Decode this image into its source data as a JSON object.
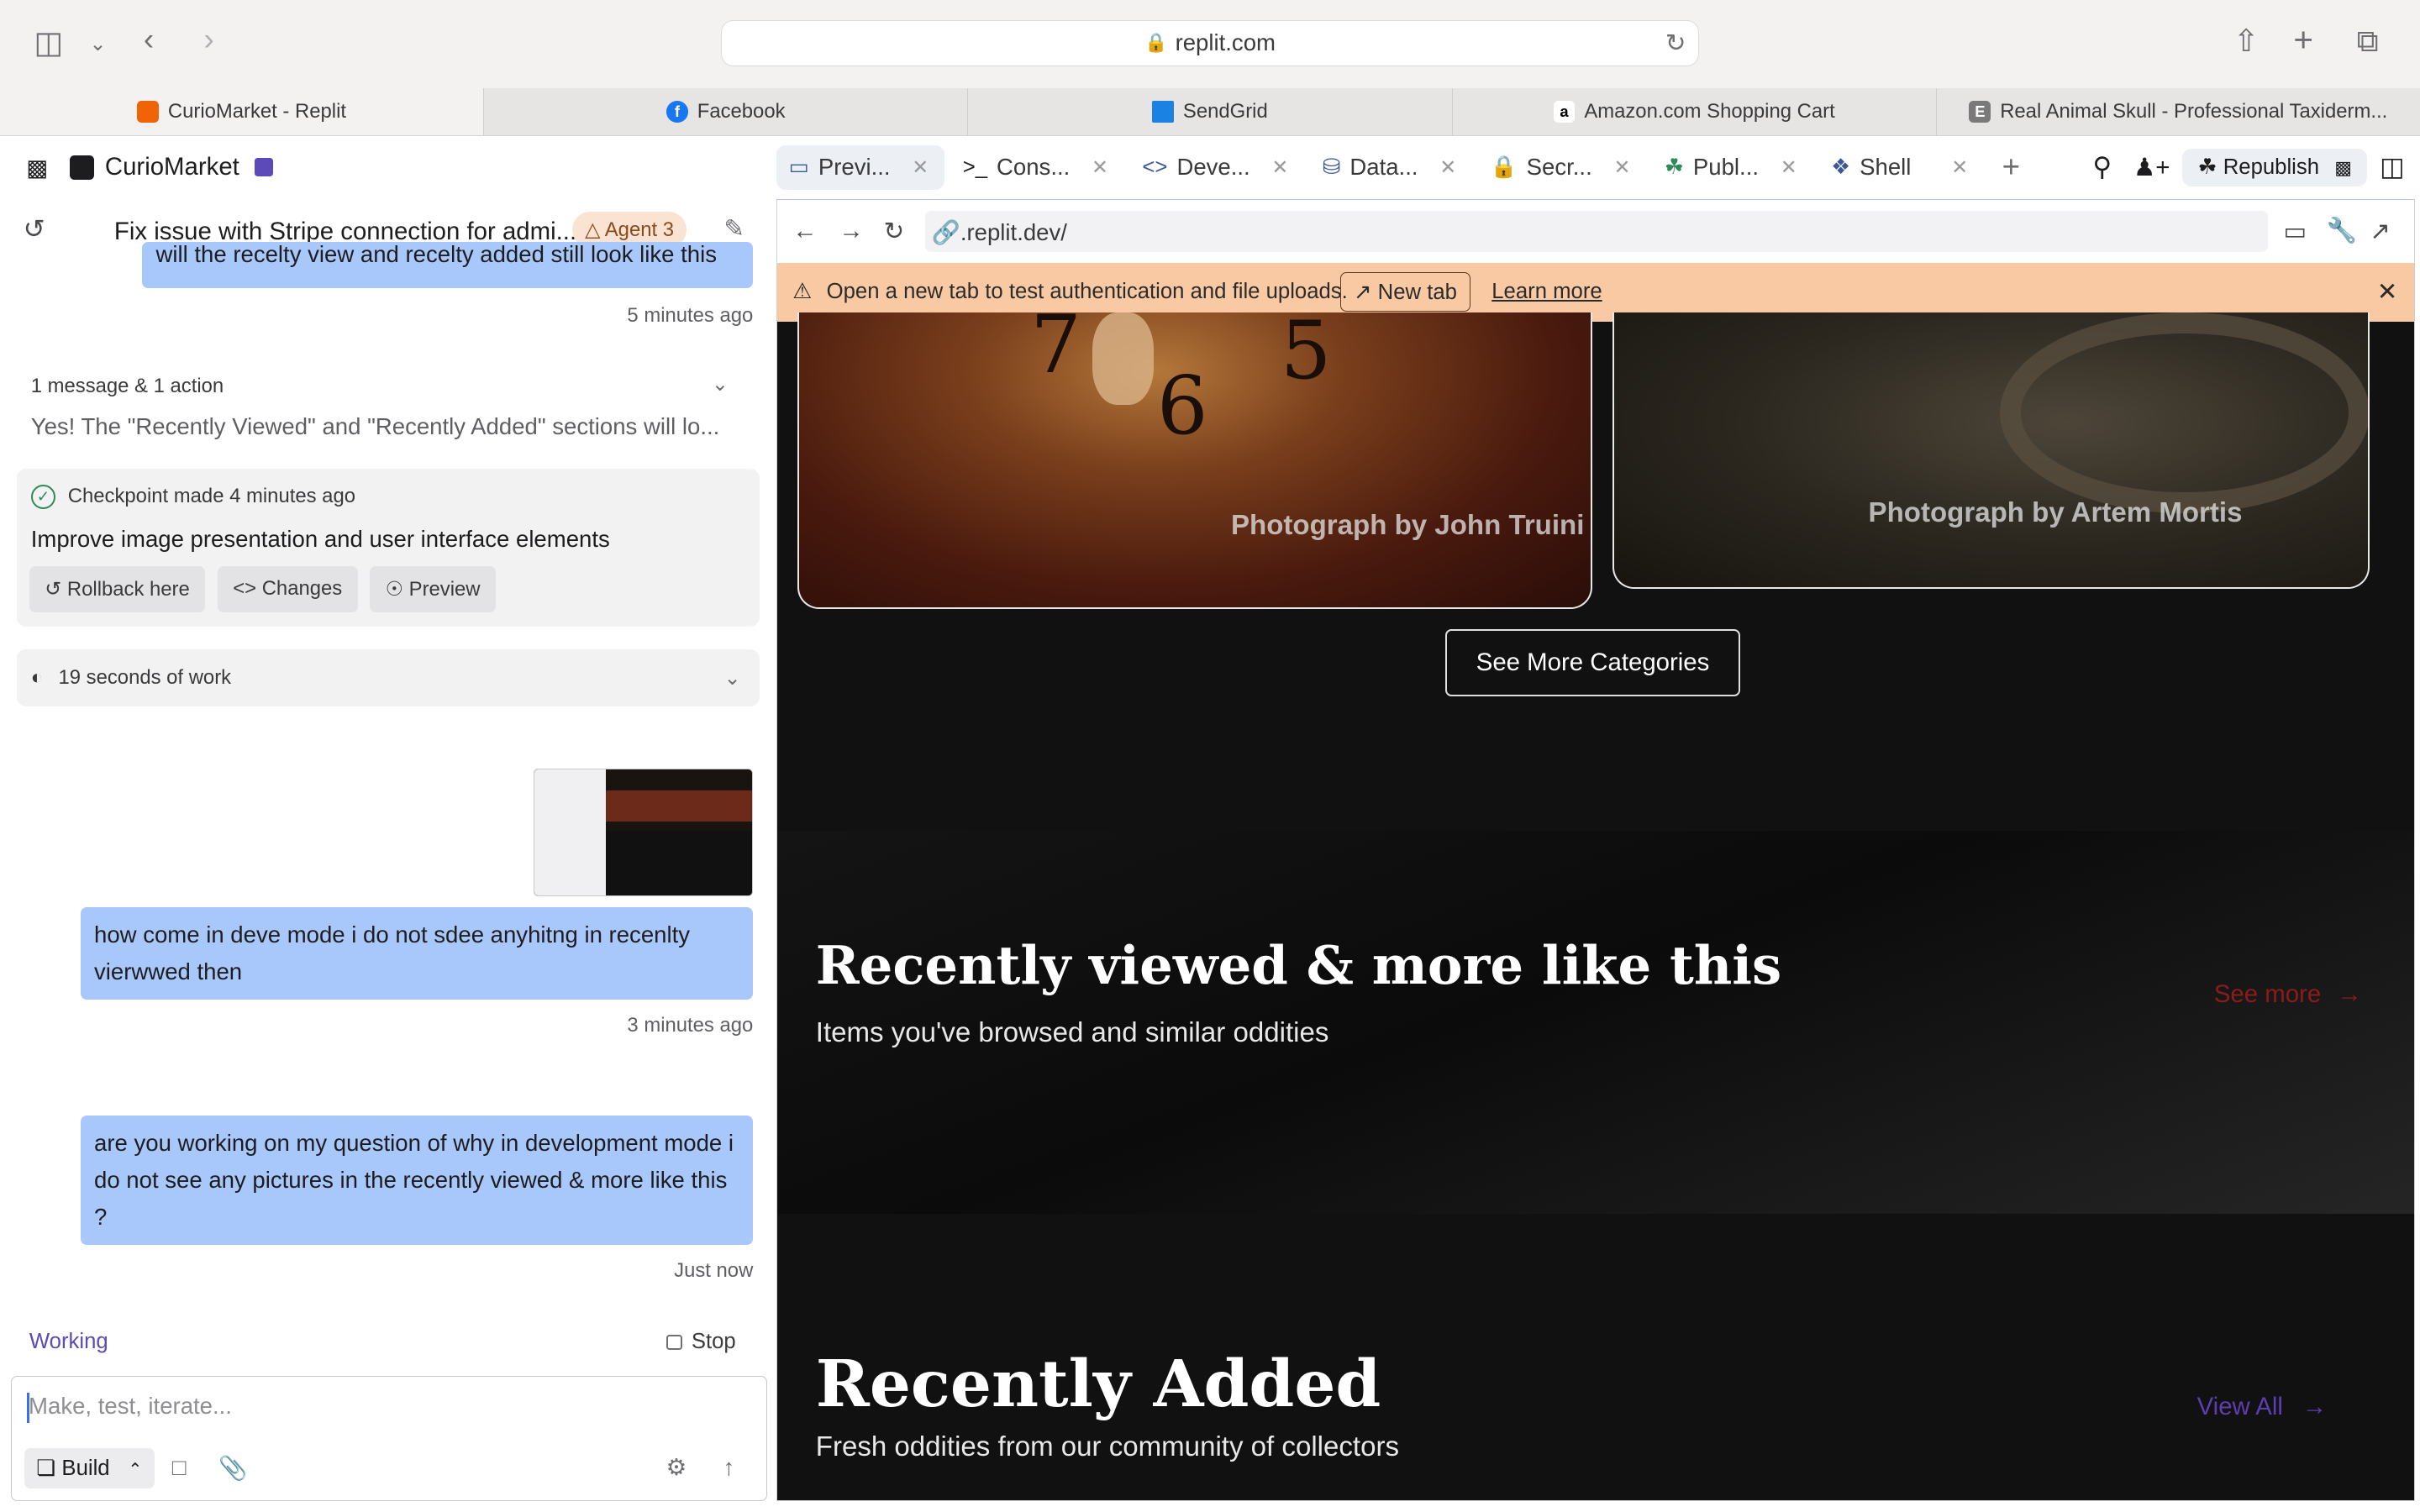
{
  "browser": {
    "url": "replit.com",
    "tabs": [
      {
        "label": "CurioMarket - Replit",
        "icon": "replit-icon",
        "color": "#f26207"
      },
      {
        "label": "Facebook",
        "icon": "facebook-icon",
        "color": "#1877f2"
      },
      {
        "label": "SendGrid",
        "icon": "sendgrid-icon",
        "color": "#1a82e2"
      },
      {
        "label": "Amazon.com Shopping Cart",
        "icon": "amazon-icon",
        "color": "#000000"
      },
      {
        "label": "Real Animal Skull - Professional Taxiderm...",
        "icon": "e-icon",
        "color": "#7a7a7a",
        "letter": "E"
      }
    ]
  },
  "project": {
    "name": "CurioMarket"
  },
  "pane_tabs": [
    {
      "label": "Previ...",
      "icon": "monitor-icon"
    },
    {
      "label": "Cons...",
      "icon": "terminal-icon"
    },
    {
      "label": "Deve...",
      "icon": "code-icon"
    },
    {
      "label": "Data...",
      "icon": "database-icon"
    },
    {
      "label": "Secr...",
      "icon": "lock-icon"
    },
    {
      "label": "Publ...",
      "icon": "publish-icon"
    },
    {
      "label": "Shell",
      "icon": "shell-icon"
    }
  ],
  "header_right": {
    "republish": "Republish"
  },
  "chat": {
    "title": "Fix issue with Stripe connection for admi...",
    "agent_badge": "Agent 3",
    "first_bubble": "will the recelty view and recelty added still look like this",
    "first_ts": "5 minutes ago",
    "actions_row": "1 message & 1 action",
    "summary": "Yes! The \"Recently Viewed\" and \"Recently Added\" sections will lo...",
    "checkpoint": {
      "label": "Checkpoint made",
      "time": "4 minutes ago",
      "message": "Improve image presentation and user interface elements",
      "buttons": [
        "Rollback here",
        "Changes",
        "Preview"
      ]
    },
    "work": "19 seconds of work",
    "bubble2": "how come in deve mode i do not sdee anyhitng in recenlty vierwwed then",
    "bubble2_ts": "3 minutes ago",
    "bubble3": "are you working on my question of why in development mode i do not see any pictures in the recently viewed & more like this ?",
    "bubble3_ts": "Just now",
    "status": "Working",
    "stop": "Stop",
    "composer_placeholder": "Make, test, iterate...",
    "build": "Build"
  },
  "preview": {
    "address": ".replit.dev/",
    "banner_text": "Open a new tab to test authentication and file uploads.",
    "new_tab": "New tab",
    "learn_more": "Learn more",
    "credit1": "Photograph by John Truini",
    "credit2": "Photograph by Artem Mortis",
    "clock_digits": [
      "7",
      "6",
      "5"
    ],
    "see_more_categories": "See More Categories",
    "recently_viewed_title": "Recently viewed & more like this",
    "recently_viewed_sub": "Items you've browsed and similar oddities",
    "see_more": "See more",
    "recently_added_title": "Recently Added",
    "recently_added_sub": "Fresh oddities from our community of collectors",
    "view_all": "View All"
  }
}
